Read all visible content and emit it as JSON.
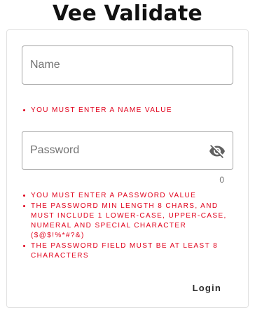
{
  "header": {
    "title": "Vee Validate"
  },
  "form": {
    "name_field": {
      "placeholder": "Name",
      "value": ""
    },
    "name_errors": [
      "You must enter a name value"
    ],
    "password_field": {
      "placeholder": "Password",
      "value": "",
      "visibility_icon": "eye-off-icon"
    },
    "password_counter": "0",
    "password_errors": [
      "You must enter a password value",
      "The password min length 8 chars, and must include 1 lower-case, upper-case, numeral and special character ($@$!%*#?&)",
      "The password field must be at least 8 characters"
    ],
    "login_label": "Login"
  },
  "colors": {
    "error": "#e0001b",
    "border": "#a6a6a6",
    "title": "#111111"
  }
}
